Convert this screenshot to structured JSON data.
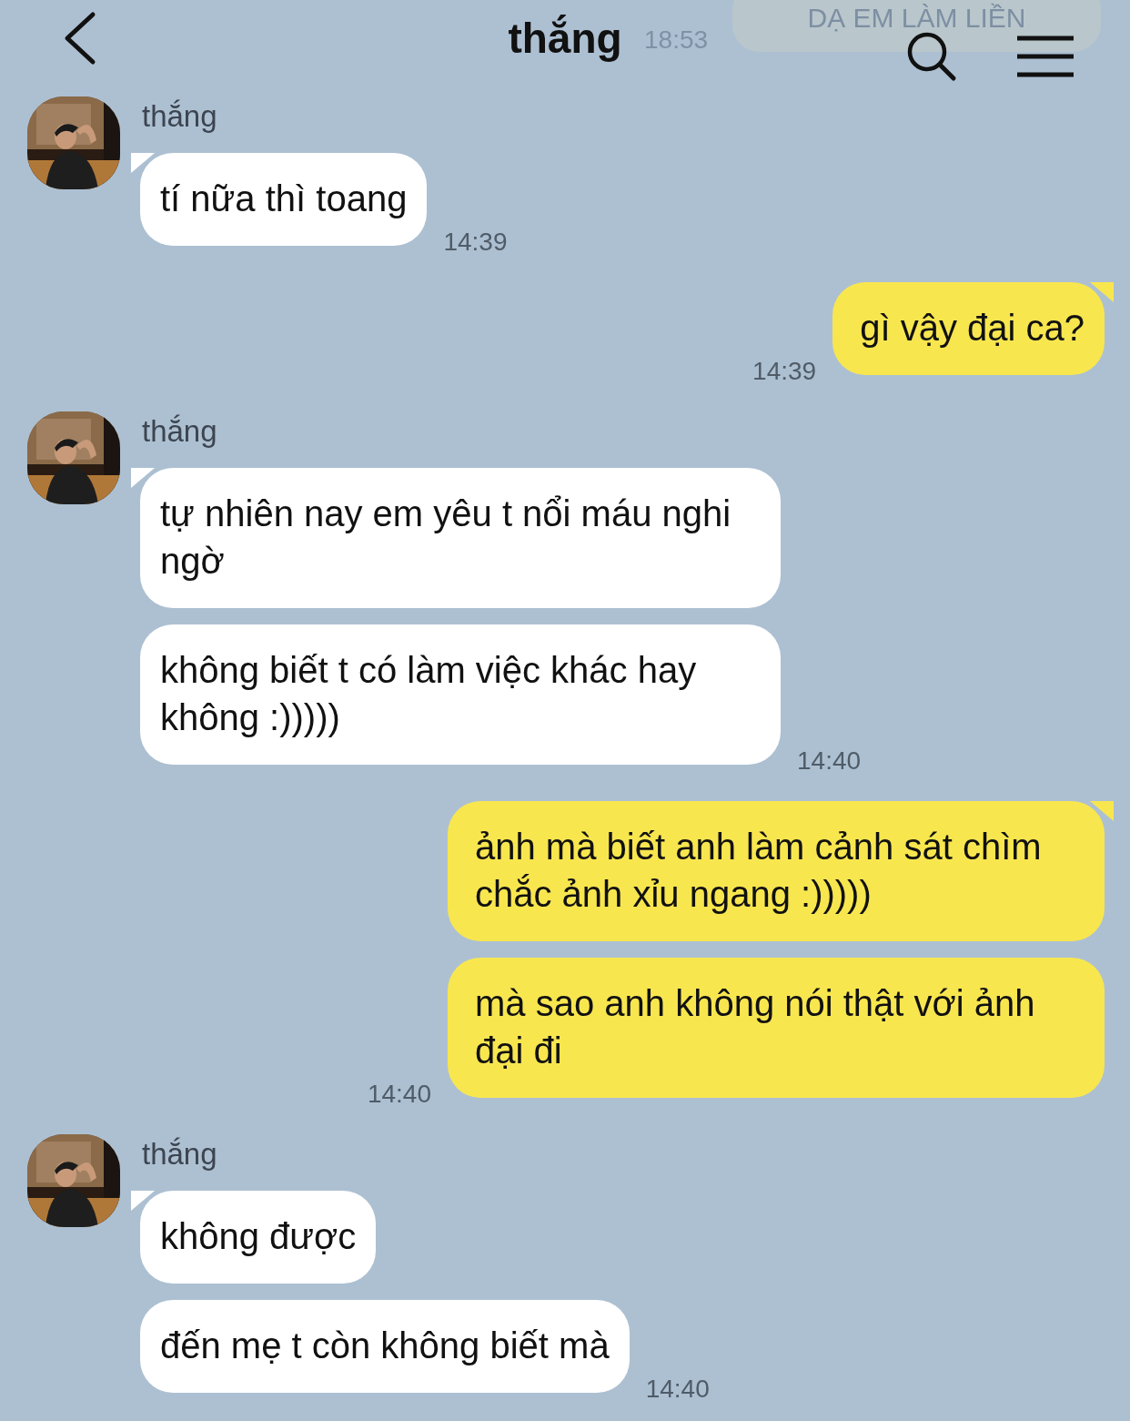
{
  "header": {
    "title": "thắng",
    "faded_message": {
      "text": "DẠ EM LÀM LIỀN",
      "time": "18:53"
    }
  },
  "groups": [
    {
      "kind": "incoming",
      "sender": "thắng",
      "time": "14:39",
      "messages": [
        "tí nữa thì toang"
      ]
    },
    {
      "kind": "outgoing",
      "time": "14:39",
      "messages": [
        "gì vậy đại ca?"
      ]
    },
    {
      "kind": "incoming",
      "sender": "thắng",
      "time": "14:40",
      "messages": [
        "tự nhiên nay em yêu t nổi máu nghi ngờ",
        "không biết t có làm việc khác hay không :)))))"
      ]
    },
    {
      "kind": "outgoing",
      "time": "14:40",
      "messages": [
        "ảnh mà biết anh làm cảnh sát chìm chắc ảnh xỉu ngang :)))))",
        "mà sao anh không nói thật với ảnh đại đi"
      ]
    },
    {
      "kind": "incoming",
      "sender": "thắng",
      "time": "14:40",
      "messages": [
        "không được",
        "đến mẹ t còn không biết mà"
      ]
    }
  ]
}
